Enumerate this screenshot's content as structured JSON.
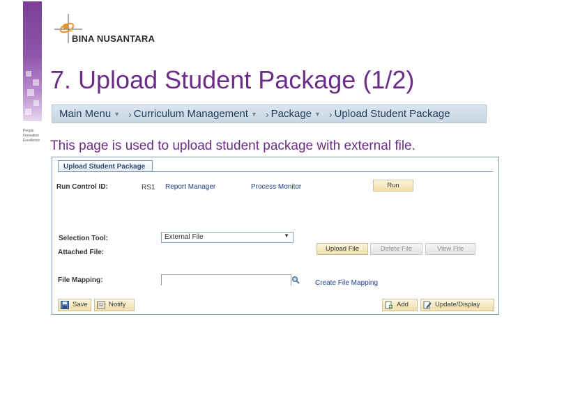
{
  "brand": {
    "logo_text": "BINA NUSANTARA",
    "tagline": [
      "People",
      "Innovation",
      "Excellence"
    ]
  },
  "slide": {
    "title": "7. Upload Student Package (1/2)",
    "description": "This page is used to upload student package with external file."
  },
  "breadcrumb": [
    "Main Menu",
    "Curriculum Management",
    "Package",
    "Upload Student Package"
  ],
  "panel": {
    "tab_label": "Upload Student Package",
    "run_control_label": "Run Control ID:",
    "run_control_value": "RS1",
    "report_manager": "Report Manager",
    "process_monitor": "Process Monitor",
    "run_button": "Run",
    "selection_tool_label": "Selection Tool:",
    "selection_tool_value": "External File",
    "attached_file_label": "Attached File:",
    "upload_button": "Upload File",
    "delete_button": "Delete File",
    "view_button": "View File",
    "file_mapping_label": "File Mapping:",
    "file_mapping_value": "",
    "create_mapping_link": "Create File Mapping"
  },
  "toolbar": {
    "save": "Save",
    "notify": "Notify",
    "add": "Add",
    "update": "Update/Display"
  },
  "colors": {
    "accent": "#6b2d86",
    "link": "#1a3f8b",
    "panel_border": "#7b9bbf",
    "button": "#f1dfaa"
  }
}
